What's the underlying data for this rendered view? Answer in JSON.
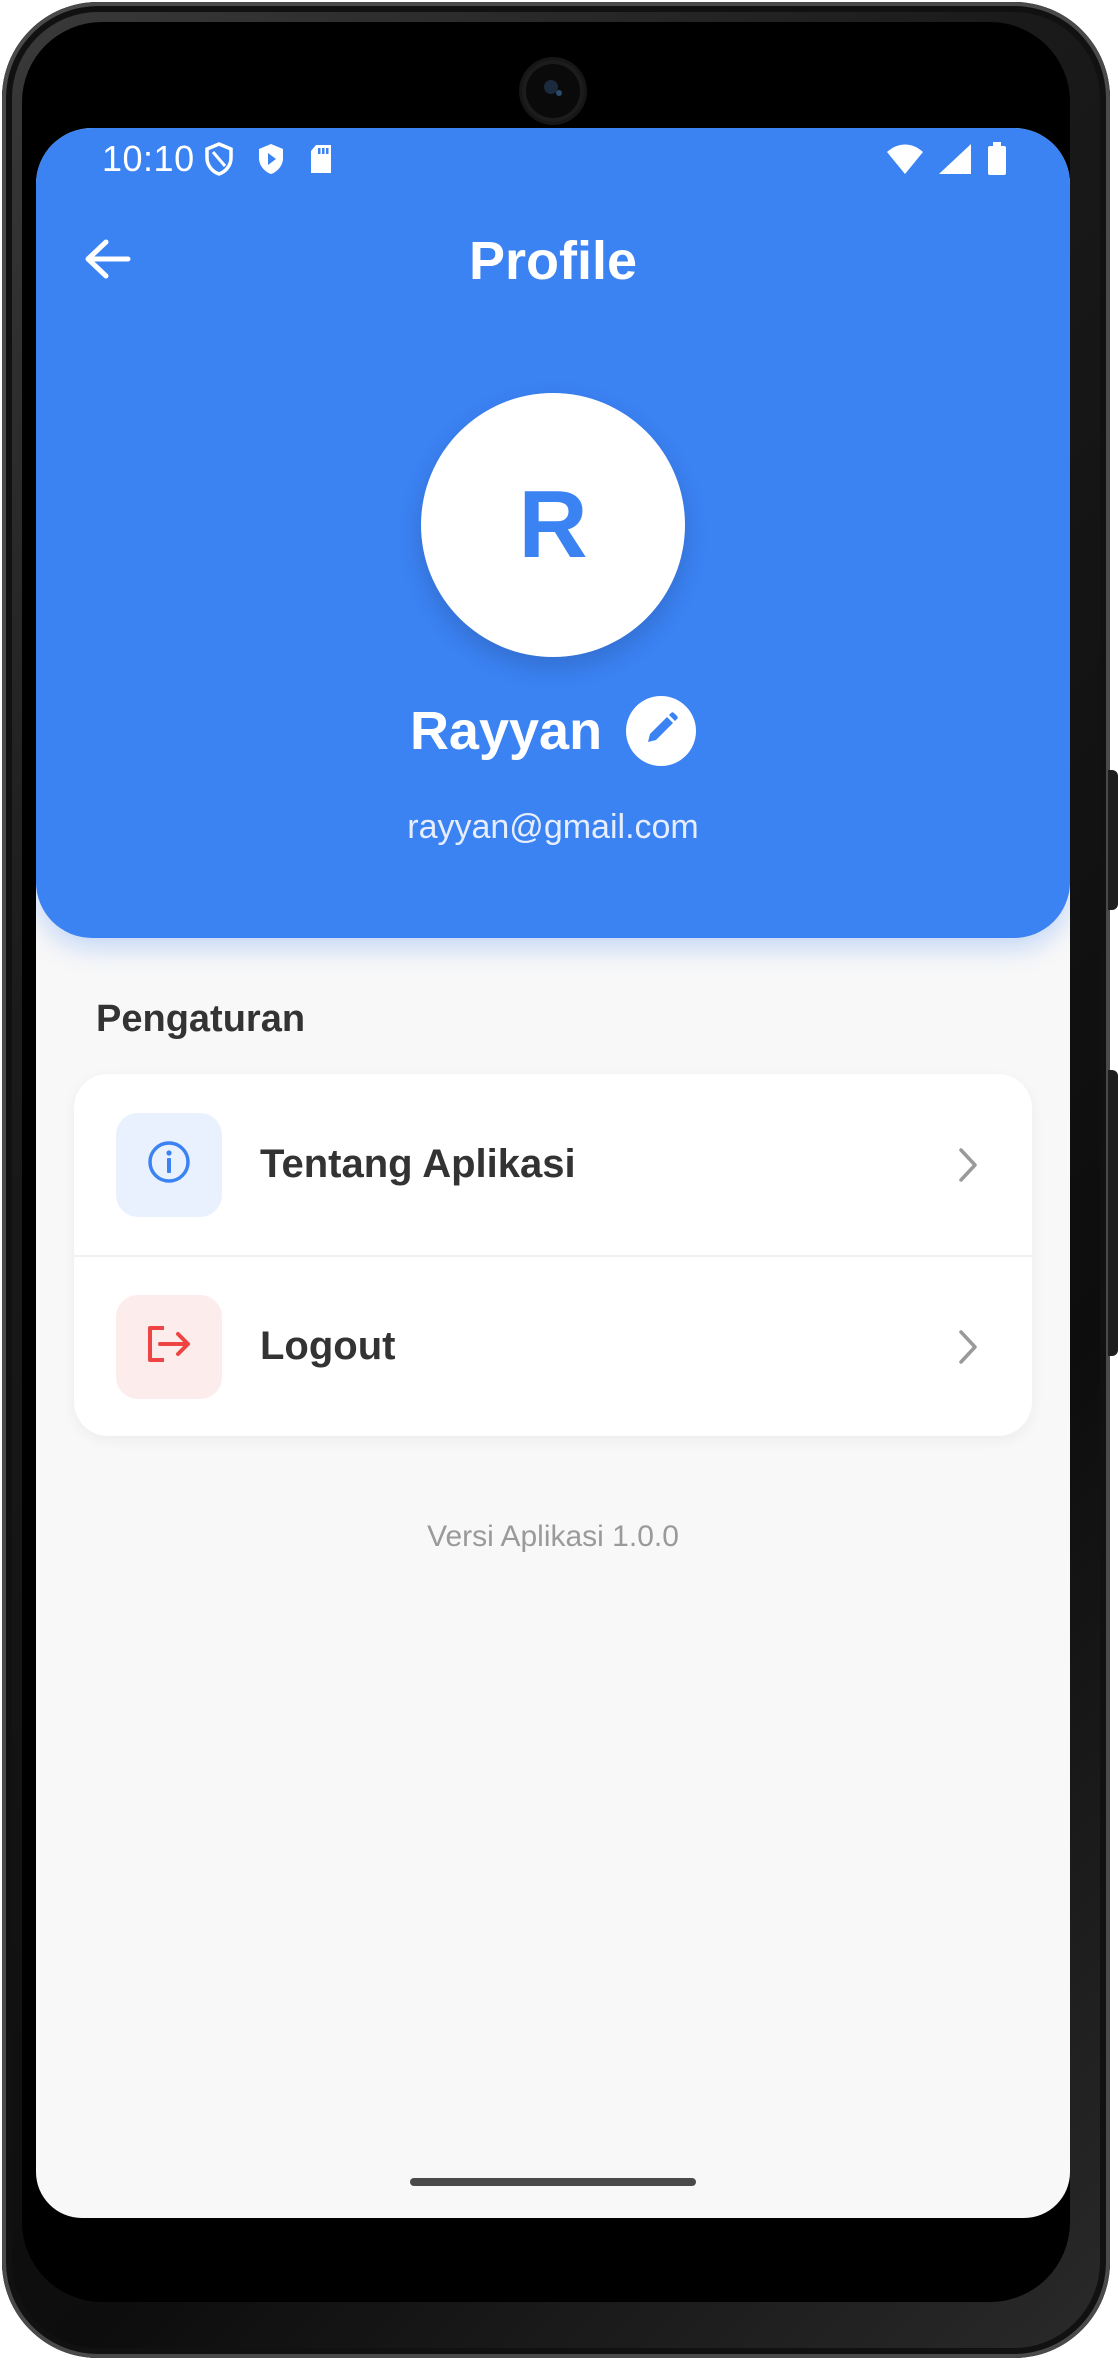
{
  "status_bar": {
    "time": "10:10",
    "left_icons": [
      "shield-outline-icon",
      "play-protect-icon",
      "sd-card-icon"
    ],
    "right_icons": [
      "wifi-icon",
      "cellular-signal-icon",
      "battery-icon"
    ]
  },
  "header": {
    "title": "Profile",
    "back_icon": "arrow-left-icon",
    "avatar_initial": "R",
    "user_name": "Rayyan",
    "edit_icon": "pencil-icon",
    "email": "rayyan@gmail.com"
  },
  "settings": {
    "section_title": "Pengaturan",
    "items": [
      {
        "label": "Tentang Aplikasi",
        "icon": "info-circle-icon",
        "icon_color": "#3b82f3",
        "icon_bg": "#eaf1fe"
      },
      {
        "label": "Logout",
        "icon": "logout-icon",
        "icon_color": "#ef4444",
        "icon_bg": "#fdecec"
      }
    ]
  },
  "footer": {
    "version_text": "Versi Aplikasi 1.0.0"
  },
  "colors": {
    "primary": "#3b82f3",
    "background": "#f8f8f8",
    "danger": "#ef4444"
  }
}
